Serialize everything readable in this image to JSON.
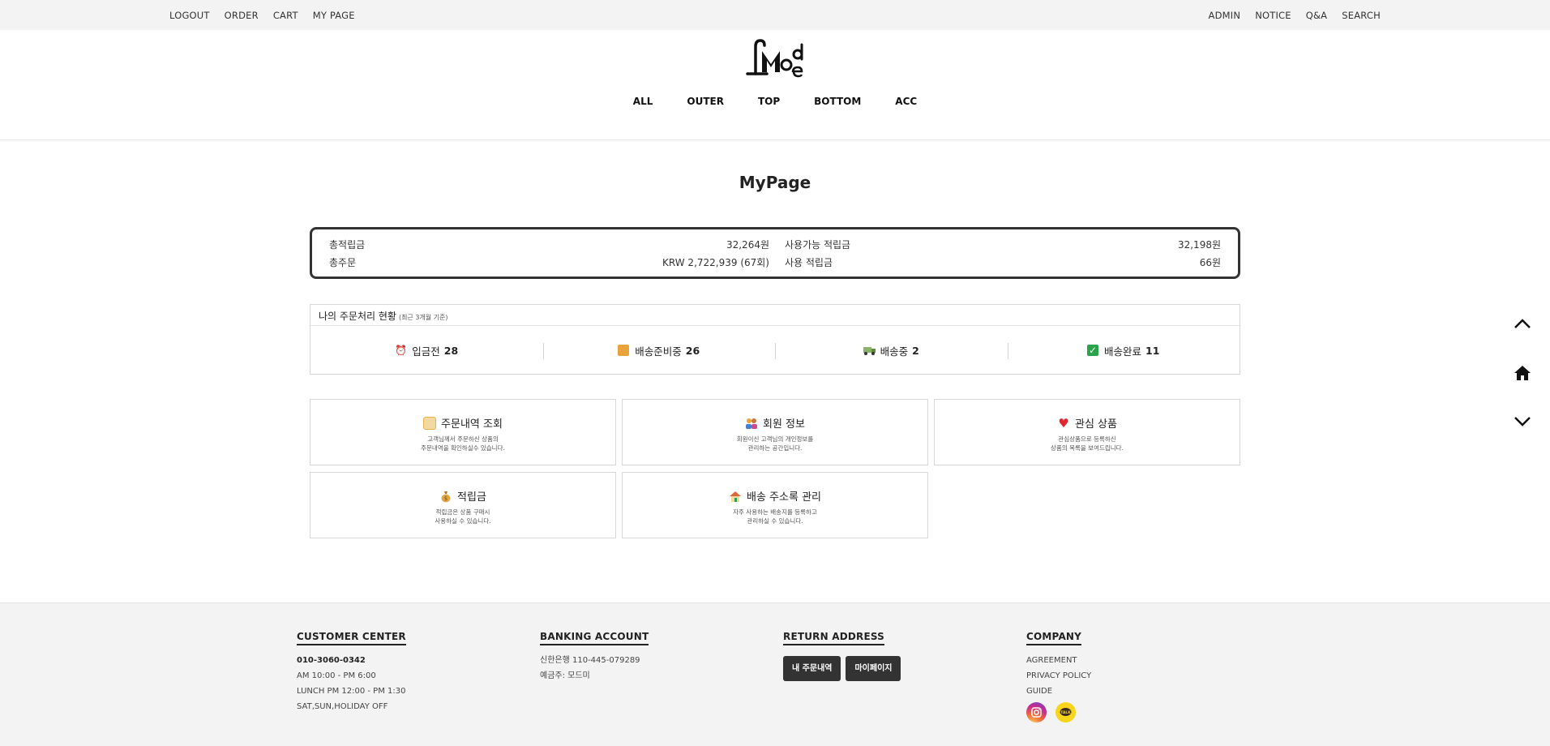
{
  "topbar": {
    "left": [
      "LOGOUT",
      "ORDER",
      "CART",
      "MY PAGE"
    ],
    "right": [
      "ADMIN",
      "NOTICE",
      "Q&A",
      "SEARCH"
    ]
  },
  "logo": {
    "text": "Mode"
  },
  "nav": [
    "ALL",
    "OUTER",
    "TOP",
    "BOTTOM",
    "ACC"
  ],
  "page_title": "MyPage",
  "summary": {
    "total_points_label": "총적립금",
    "total_points_value": "32,264원",
    "available_points_label": "사용가능 적립금",
    "available_points_value": "32,198원",
    "total_orders_label": "총주문",
    "total_orders_value": "KRW 2,722,939 (67회)",
    "used_points_label": "사용 적립금",
    "used_points_value": "66원"
  },
  "order_status": {
    "title": "나의 주문처리 현황",
    "subtitle": "(최근 3개월 기준)",
    "items": [
      {
        "label": "입금전",
        "count": "28",
        "icon": "alarm-clock-icon",
        "color": "#e0483e"
      },
      {
        "label": "배송준비중",
        "count": "26",
        "icon": "package-icon",
        "color": "#e8a33c"
      },
      {
        "label": "배송중",
        "count": "2",
        "icon": "truck-icon",
        "color": "#5a8f3a"
      },
      {
        "label": "배송완료",
        "count": "11",
        "icon": "checkbox-icon",
        "color": "#2aa34a"
      }
    ]
  },
  "cards": [
    {
      "title": "주문내역 조회",
      "desc1": "고객님께서 주문하신 상품의",
      "desc2": "주문내역을 확인하실수 있습니다.",
      "icon": "scroll-icon",
      "color": "#e8b04a"
    },
    {
      "title": "회원 정보",
      "desc1": "회원이신 고객님의 개인정보를",
      "desc2": "관리하는 공간입니다.",
      "icon": "people-icon",
      "color": "#e07a3a"
    },
    {
      "title": "관심 상품",
      "desc1": "관심상품으로 등록하신",
      "desc2": "상품의 목록을 보여드립니다.",
      "icon": "heart-icon",
      "color": "#e0272f"
    },
    {
      "title": "적립금",
      "desc1": "적립금은 상품 구매시",
      "desc2": "사용하실 수 있습니다.",
      "icon": "money-bag-icon",
      "color": "#d89a3a"
    },
    {
      "title": "배송 주소록 관리",
      "desc1": "자주 사용하는 배송지를 등록하고",
      "desc2": "관리하실 수 있습니다.",
      "icon": "house-icon",
      "color": "#d86a3a"
    }
  ],
  "footer": {
    "customer_center": {
      "title": "CUSTOMER CENTER",
      "phone": "010-3060-0342",
      "hours": "AM 10:00 - PM 6:00",
      "lunch": "LUNCH PM 12:00 - PM 1:30",
      "off": "SAT,SUN,HOLIDAY OFF"
    },
    "banking": {
      "title": "BANKING ACCOUNT",
      "account": "신한은행 110-445-079289",
      "holder": "예금주: 모드미"
    },
    "return": {
      "title": "RETURN ADDRESS",
      "btn_orders": "내 주문내역",
      "btn_mypage": "마이페이지"
    },
    "company": {
      "title": "COMPANY",
      "links": [
        "AGREEMENT",
        "PRIVACY POLICY",
        "GUIDE"
      ]
    }
  }
}
